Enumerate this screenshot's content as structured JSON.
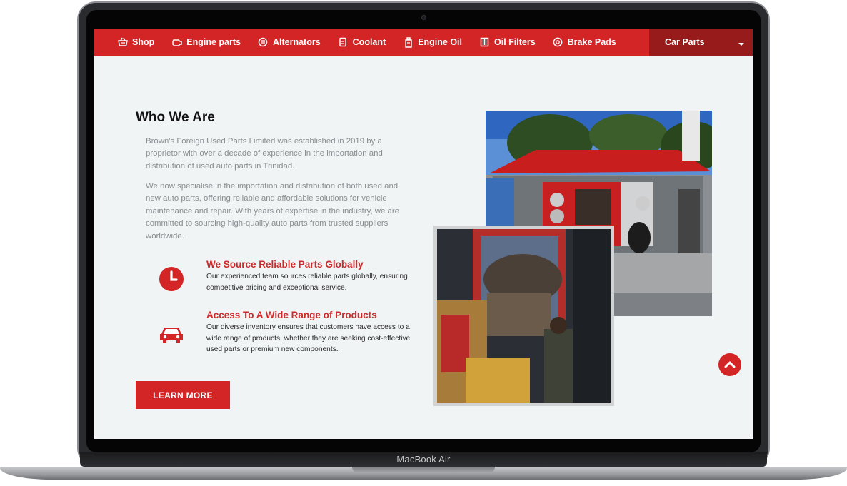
{
  "device": {
    "label": "MacBook Air"
  },
  "nav": {
    "items": [
      {
        "label": "Shop",
        "icon": "basket-icon"
      },
      {
        "label": "Engine parts",
        "icon": "engine-icon"
      },
      {
        "label": "Alternators",
        "icon": "alternator-icon"
      },
      {
        "label": "Coolant",
        "icon": "coolant-icon"
      },
      {
        "label": "Engine Oil",
        "icon": "oil-can-icon"
      },
      {
        "label": "Oil Filters",
        "icon": "oil-filter-icon"
      },
      {
        "label": "Brake Pads",
        "icon": "brake-disc-icon"
      }
    ],
    "dropdown_label": "Car Parts"
  },
  "about": {
    "title": "Who We Are",
    "paragraph1": "Brown's Foreign Used Parts Limited was established in 2019 by a proprietor with over a decade of experience in the importation and distribution of used auto parts in Trinidad.",
    "paragraph2": "We now specialise in the importation and distribution of both used and new auto parts, offering reliable and affordable solutions for vehicle maintenance and repair. With years of expertise in the industry, we are committed to sourcing high-quality auto parts from trusted suppliers worldwide."
  },
  "features": [
    {
      "title": "We Source Reliable Parts Globally",
      "text": "Our experienced team sources reliable parts globally, ensuring competitive pricing and exceptional service.",
      "icon": "clock-icon"
    },
    {
      "title": "Access To A Wide Range of Products",
      "text": "Our diverse inventory ensures that customers have access to a wide range of products, whether they are seeking cost-effective used parts or premium new components.",
      "icon": "car-icon"
    }
  ],
  "cta": {
    "label": "LEARN MORE"
  },
  "colors": {
    "brand_red": "#d42526",
    "dark_red": "#971b1b",
    "background": "#f1f4f5"
  }
}
